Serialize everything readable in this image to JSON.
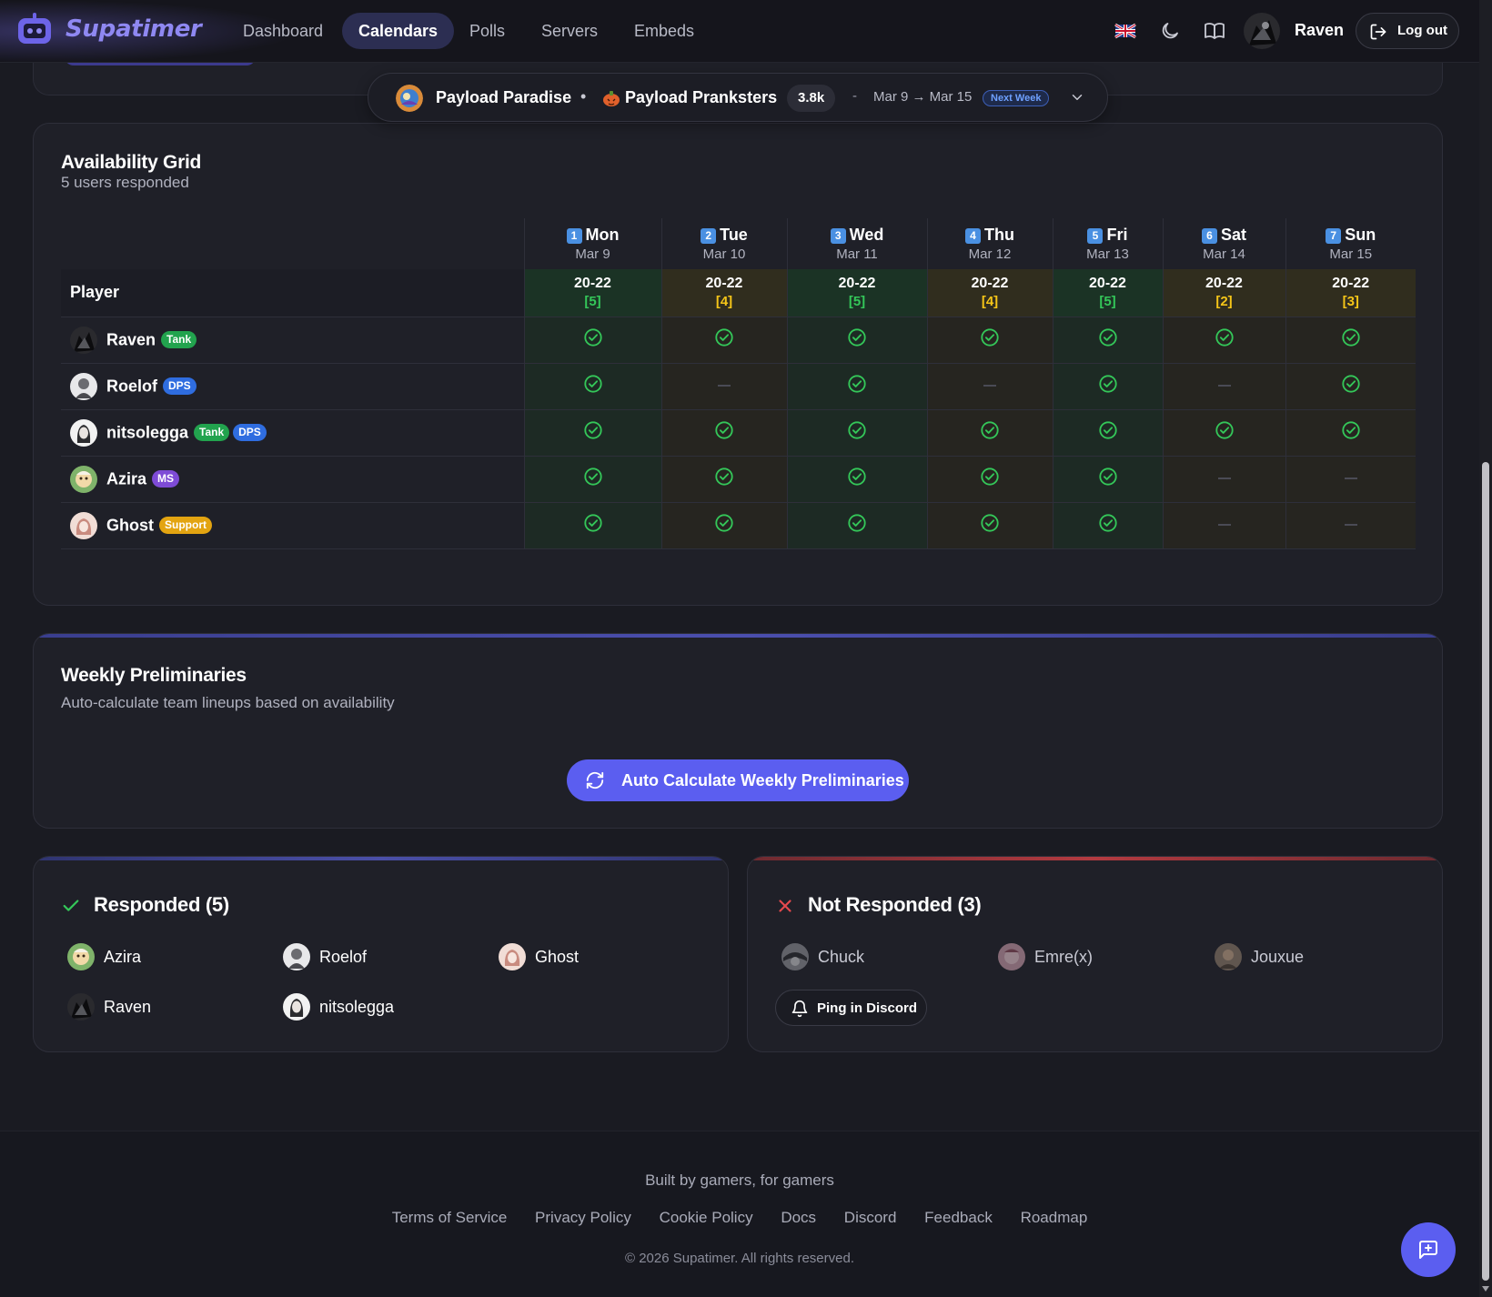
{
  "nav": {
    "brand": "Supatimer",
    "links": [
      "Dashboard",
      "Calendars",
      "Polls",
      "Servers",
      "Embeds"
    ],
    "active": "Calendars",
    "icons": [
      "uk-flag-icon",
      "moon-icon",
      "book-icon"
    ],
    "user": "Raven",
    "logout": "Log out"
  },
  "selector": {
    "server": "Payload Paradise",
    "separator": "•",
    "team": "Payload Pranksters",
    "count": "3.8k",
    "dash": "-",
    "range": "Mar 9 → Mar 15",
    "badge": "Next Week"
  },
  "grid": {
    "title": "Availability Grid",
    "subtitle": "5 users responded",
    "player_header": "Player",
    "days": [
      {
        "num": "1",
        "name": "Mon",
        "date": "Mar 9",
        "time": "20-22",
        "count": "[5]",
        "full": true
      },
      {
        "num": "2",
        "name": "Tue",
        "date": "Mar 10",
        "time": "20-22",
        "count": "[4]",
        "full": false
      },
      {
        "num": "3",
        "name": "Wed",
        "date": "Mar 11",
        "time": "20-22",
        "count": "[5]",
        "full": true
      },
      {
        "num": "4",
        "name": "Thu",
        "date": "Mar 12",
        "time": "20-22",
        "count": "[4]",
        "full": false
      },
      {
        "num": "5",
        "name": "Fri",
        "date": "Mar 13",
        "time": "20-22",
        "count": "[5]",
        "full": true
      },
      {
        "num": "6",
        "name": "Sat",
        "date": "Mar 14",
        "time": "20-22",
        "count": "[2]",
        "full": false
      },
      {
        "num": "7",
        "name": "Sun",
        "date": "Mar 15",
        "time": "20-22",
        "count": "[3]",
        "full": false
      }
    ],
    "players": [
      {
        "name": "Raven",
        "roles": [
          "Tank"
        ],
        "avail": [
          true,
          true,
          true,
          true,
          true,
          true,
          true
        ]
      },
      {
        "name": "Roelof",
        "roles": [
          "DPS"
        ],
        "avail": [
          true,
          false,
          true,
          false,
          true,
          false,
          true
        ]
      },
      {
        "name": "nitsolegga",
        "roles": [
          "Tank",
          "DPS"
        ],
        "avail": [
          true,
          true,
          true,
          true,
          true,
          true,
          true
        ]
      },
      {
        "name": "Azira",
        "roles": [
          "MS"
        ],
        "avail": [
          true,
          true,
          true,
          true,
          true,
          false,
          false
        ]
      },
      {
        "name": "Ghost",
        "roles": [
          "Support"
        ],
        "avail": [
          true,
          true,
          true,
          true,
          true,
          false,
          false
        ]
      }
    ]
  },
  "prelims": {
    "title": "Weekly Preliminaries",
    "subtitle": "Auto-calculate team lineups based on availability",
    "button": "Auto Calculate Weekly Preliminaries"
  },
  "responded": {
    "title": "Responded (5)",
    "users": [
      "Azira",
      "Roelof",
      "Ghost",
      "Raven",
      "nitsolegga"
    ]
  },
  "not_responded": {
    "title": "Not Responded (3)",
    "users": [
      "Chuck",
      "Emre(x)",
      "Jouxue"
    ],
    "ping": "Ping in Discord"
  },
  "footer": {
    "tagline": "Built by gamers, for gamers",
    "links": [
      "Terms of Service",
      "Privacy Policy",
      "Cookie Policy",
      "Docs",
      "Discord",
      "Feedback",
      "Roadmap"
    ],
    "copyright": "© 2026 Supatimer. All rights reserved."
  },
  "colors": {
    "accent": "#5b5ef0",
    "brand": "#8f88f2",
    "available": "#34c759",
    "partial": "#f5c518",
    "not_responded": "#e5484d"
  }
}
